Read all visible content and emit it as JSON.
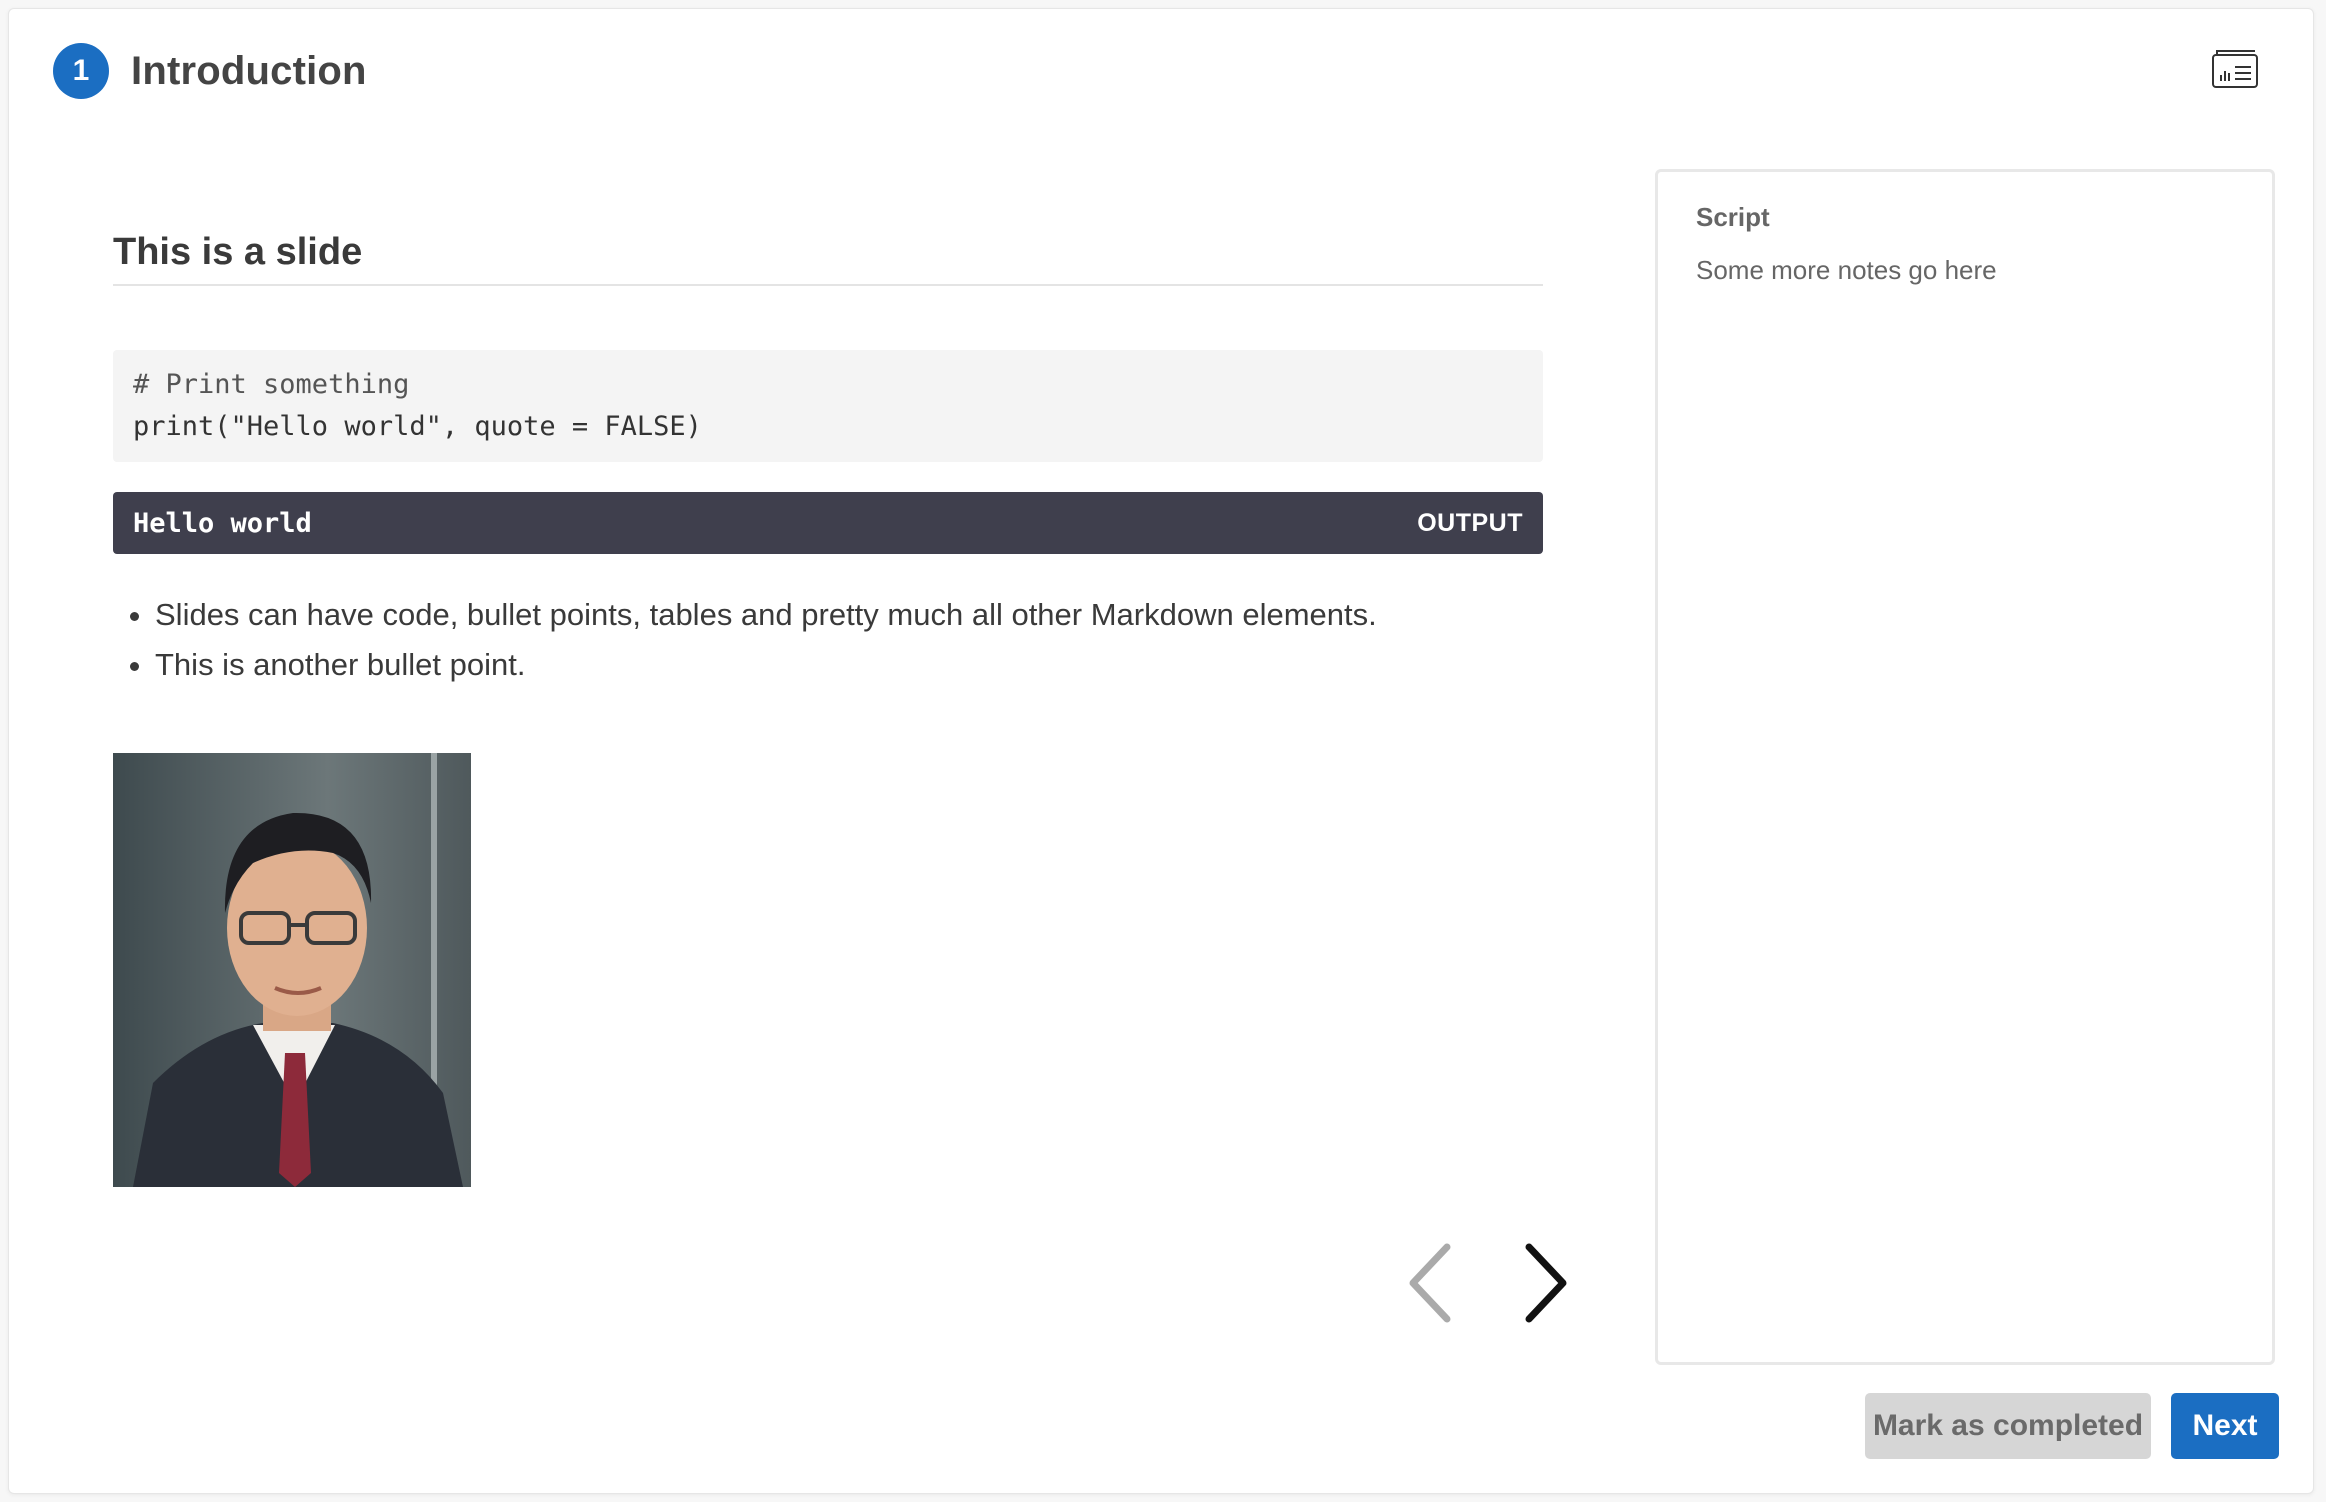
{
  "header": {
    "step_number": "1",
    "title": "Introduction",
    "view_toggle_icon": "slides-view-icon"
  },
  "slide": {
    "title": "This is a slide",
    "code": {
      "comment": "# Print something",
      "line": "print(\"Hello world\", quote = FALSE)"
    },
    "output": {
      "text": "Hello world",
      "label": "OUTPUT"
    },
    "bullets": [
      "Slides can have code, bullet points, tables and pretty much all other Markdown elements.",
      "This is another bullet point."
    ]
  },
  "navigation": {
    "prev_icon": "chevron-left-icon",
    "next_icon": "chevron-right-icon"
  },
  "script_panel": {
    "label": "Script",
    "notes": "Some more notes go here"
  },
  "actions": {
    "mark_completed_label": "Mark as completed",
    "next_label": "Next"
  },
  "colors": {
    "accent": "#1b6ec2",
    "output_bg": "#3f3f4d",
    "disabled_button": "#d6d6d6"
  }
}
